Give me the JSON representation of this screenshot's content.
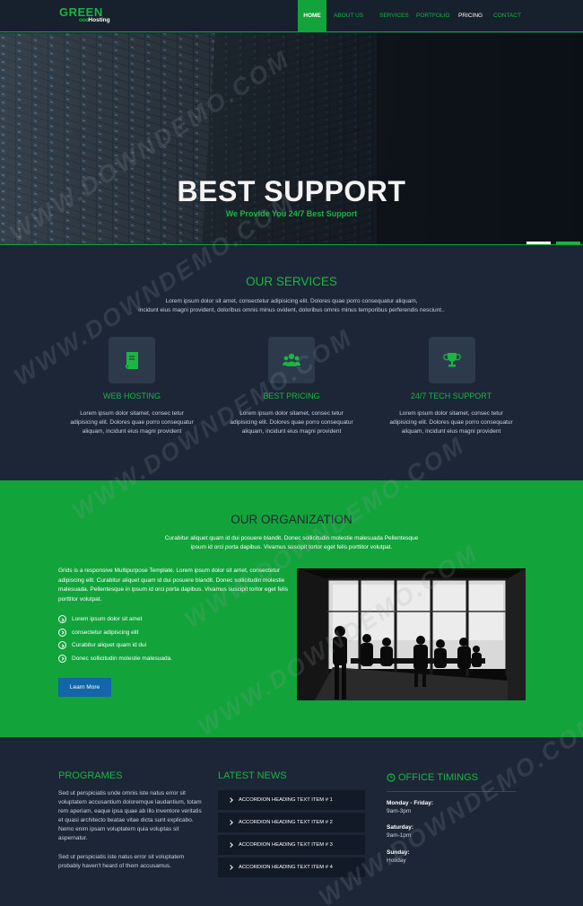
{
  "brand": {
    "name": "GREEN",
    "tagline_dots": "ooo",
    "tagline": "Hosting"
  },
  "nav": [
    {
      "label": "HOME",
      "active": true
    },
    {
      "label": "ABOUT US",
      "active": false
    },
    {
      "label": "SERVICES",
      "active": false
    },
    {
      "label": "PORTFOLIO",
      "active": false
    },
    {
      "label": "PRICING",
      "active": false
    },
    {
      "label": "CONTACT",
      "active": false
    }
  ],
  "hero": {
    "title": "BEST SUPPORT",
    "subtitle": "We Provide You 24/7 Best Support"
  },
  "services": {
    "title": "OUR SERVICES",
    "intro_line1": "Lorem ipsum dolor sit amet, consectetur adipisicing elit. Dolores quae porro consequatur aliquam,",
    "intro_line2": "incidunt eius magni provident, doloribus omnis minus ovident, doloribus omnis minus temporibus perferendis nesciunt..",
    "items": [
      {
        "icon": "book-icon",
        "title": "WEB HOSTING",
        "line1": "Lorem ipsum dolor sitamet, consec tetur",
        "line2": "adipisicing elit. Dolores quae porro consequatur",
        "line3": "aliquam, incidunt eius magni provident"
      },
      {
        "icon": "users-icon",
        "title": "BEST PRICING",
        "line1": "Lorem ipsum dolor sitamet, consec tetur",
        "line2": "adipisicing elit. Dolores quae porro consequatur",
        "line3": "aliquam, incidunt eius magni provident"
      },
      {
        "icon": "trophy-icon",
        "title": "24/7 TECH SUPPORT",
        "line1": "Lorem ipsum dolor sitamet, consec tetur",
        "line2": "adipisicing elit. Dolores quae porro consequatur",
        "line3": "aliquam, incidunt eius magni provident"
      }
    ]
  },
  "organization": {
    "title": "OUR ORGANIZATION",
    "intro_line1": "Curabitur aliquet quam id dui posuere blandit. Donec sollicitudin molestie malesuada Pellentesque",
    "intro_line2": "ipsum id orci porta dapibus. Vivamus suscipit tortor eget felis porttitor volutpat.",
    "paragraph": "Grids is a responsive Multipurpose Template. Lorem ipsum dolor sit amet, consectetur adipiscing elit. Curabitur aliquet quam id dui posuere blandit. Donec sollicitudin molestie malesuada. Pellentesque in ipsum id orci porta dapibus. Vivamus suscipit tortor eget felis porttitor volutpat.",
    "list": [
      "Lorem ipsum dolor sit amet",
      "consectetur adipiscing elit",
      "Curabitur aliquet quam id dui",
      "Donec sollicitudin molestie malesuada."
    ],
    "button": "Learn More"
  },
  "footer": {
    "programes": {
      "title": "PROGRAMES",
      "para1": "Sed ut perspiciatis unde omnis iste natus error sit voluptatem accusantium doloremque laudantium, totam rem aperiam, eaque ipsa quae ab illo inventore veritatis et quasi architecto beatae vitae dicta sunt explicabo. Nemo enim ipsam voluptatem quia voluptas sit aspernatur.",
      "para2": "Sed ut perspiciatis iste natus error sit voluptatem probably haven't heard of them accusamus."
    },
    "news": {
      "title": "LATEST NEWS",
      "items": [
        "ACCORDION HEADING TEXT ITEM # 1",
        "ACCORDION HEADING TEXT ITEM # 2",
        "ACCORDION HEADING TEXT ITEM # 3",
        "ACCORDION HEADING TEXT ITEM # 4"
      ]
    },
    "timings": {
      "title": "OFFICE TIMINGS",
      "rows": [
        {
          "day": "Monday - Friday:",
          "hours": "9am-3pm"
        },
        {
          "day": "Saturday:",
          "hours": "9am-1pm"
        },
        {
          "day": "Sunday:",
          "hours": "Holiday"
        }
      ]
    }
  },
  "watermark": "WWW.DOWNDEMO.COM",
  "colors": {
    "green": "#1bb543",
    "green_band": "#12a33a",
    "navy": "#1c2636",
    "button_blue": "#1466a8"
  }
}
